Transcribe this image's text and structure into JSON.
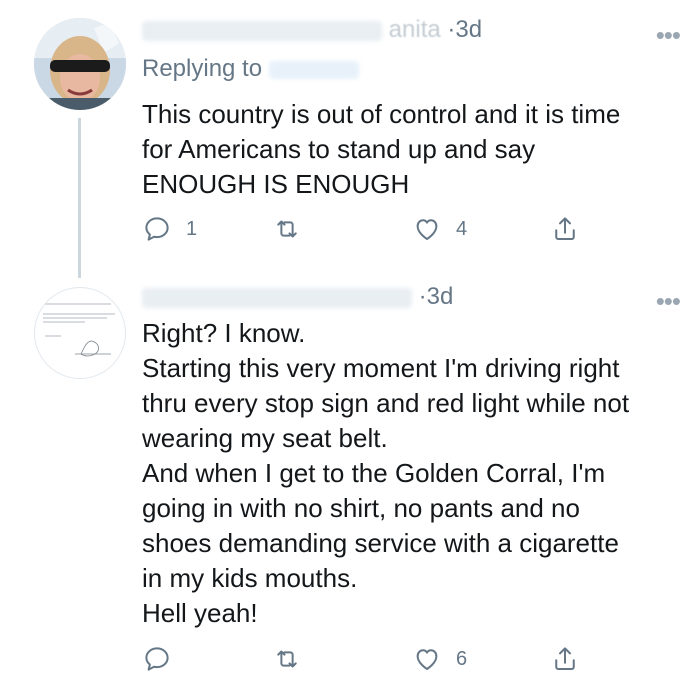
{
  "tweets": [
    {
      "time": "3d",
      "name_fragment": "anita",
      "replying_to_label": "Replying to",
      "lines": [
        "This country is out of control and it is time",
        "for Americans to stand up and say",
        "ENOUGH IS ENOUGH"
      ],
      "reply_count": "1",
      "retweet_count": "",
      "like_count": "4"
    },
    {
      "time": "3d",
      "lines": [
        "Right? I know.",
        "Starting this very moment I'm driving right",
        "thru every stop sign and red light while not",
        "wearing my seat belt.",
        "And when I get to the Golden Corral, I'm",
        "going in with no shirt, no pants and no",
        "shoes demanding service with a cigarette",
        "in my kids mouths.",
        "Hell yeah!"
      ],
      "reply_count": "",
      "retweet_count": "",
      "like_count": "6"
    }
  ],
  "icons": {
    "more": "more-horizontal-icon",
    "reply": "speech-bubble-icon",
    "retweet": "retweet-icon",
    "like": "heart-icon",
    "share": "share-icon"
  },
  "colors": {
    "text": "#14171a",
    "muted": "#657786",
    "thread_line": "#ccd6dd"
  }
}
